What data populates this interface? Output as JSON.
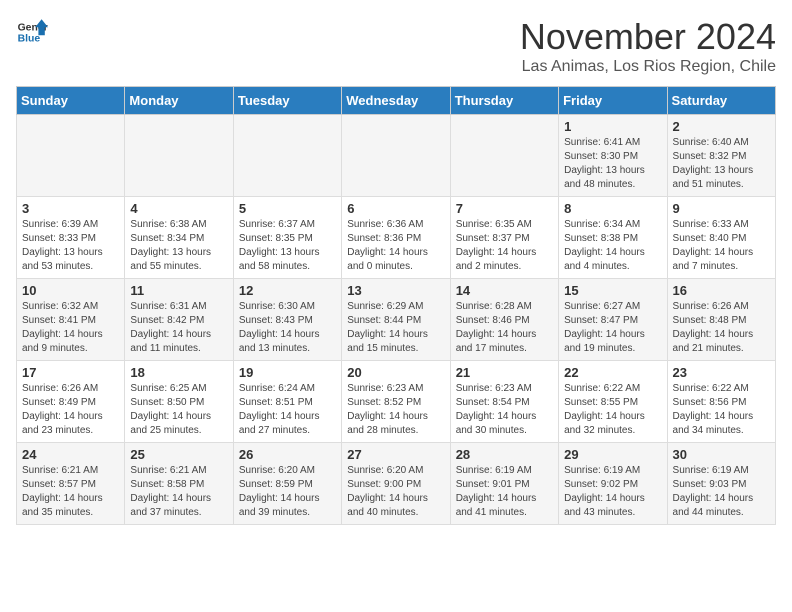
{
  "logo": {
    "line1": "General",
    "line2": "Blue"
  },
  "title": "November 2024",
  "location": "Las Animas, Los Rios Region, Chile",
  "weekdays": [
    "Sunday",
    "Monday",
    "Tuesday",
    "Wednesday",
    "Thursday",
    "Friday",
    "Saturday"
  ],
  "weeks": [
    [
      {
        "day": "",
        "detail": ""
      },
      {
        "day": "",
        "detail": ""
      },
      {
        "day": "",
        "detail": ""
      },
      {
        "day": "",
        "detail": ""
      },
      {
        "day": "",
        "detail": ""
      },
      {
        "day": "1",
        "detail": "Sunrise: 6:41 AM\nSunset: 8:30 PM\nDaylight: 13 hours and 48 minutes."
      },
      {
        "day": "2",
        "detail": "Sunrise: 6:40 AM\nSunset: 8:32 PM\nDaylight: 13 hours and 51 minutes."
      }
    ],
    [
      {
        "day": "3",
        "detail": "Sunrise: 6:39 AM\nSunset: 8:33 PM\nDaylight: 13 hours and 53 minutes."
      },
      {
        "day": "4",
        "detail": "Sunrise: 6:38 AM\nSunset: 8:34 PM\nDaylight: 13 hours and 55 minutes."
      },
      {
        "day": "5",
        "detail": "Sunrise: 6:37 AM\nSunset: 8:35 PM\nDaylight: 13 hours and 58 minutes."
      },
      {
        "day": "6",
        "detail": "Sunrise: 6:36 AM\nSunset: 8:36 PM\nDaylight: 14 hours and 0 minutes."
      },
      {
        "day": "7",
        "detail": "Sunrise: 6:35 AM\nSunset: 8:37 PM\nDaylight: 14 hours and 2 minutes."
      },
      {
        "day": "8",
        "detail": "Sunrise: 6:34 AM\nSunset: 8:38 PM\nDaylight: 14 hours and 4 minutes."
      },
      {
        "day": "9",
        "detail": "Sunrise: 6:33 AM\nSunset: 8:40 PM\nDaylight: 14 hours and 7 minutes."
      }
    ],
    [
      {
        "day": "10",
        "detail": "Sunrise: 6:32 AM\nSunset: 8:41 PM\nDaylight: 14 hours and 9 minutes."
      },
      {
        "day": "11",
        "detail": "Sunrise: 6:31 AM\nSunset: 8:42 PM\nDaylight: 14 hours and 11 minutes."
      },
      {
        "day": "12",
        "detail": "Sunrise: 6:30 AM\nSunset: 8:43 PM\nDaylight: 14 hours and 13 minutes."
      },
      {
        "day": "13",
        "detail": "Sunrise: 6:29 AM\nSunset: 8:44 PM\nDaylight: 14 hours and 15 minutes."
      },
      {
        "day": "14",
        "detail": "Sunrise: 6:28 AM\nSunset: 8:46 PM\nDaylight: 14 hours and 17 minutes."
      },
      {
        "day": "15",
        "detail": "Sunrise: 6:27 AM\nSunset: 8:47 PM\nDaylight: 14 hours and 19 minutes."
      },
      {
        "day": "16",
        "detail": "Sunrise: 6:26 AM\nSunset: 8:48 PM\nDaylight: 14 hours and 21 minutes."
      }
    ],
    [
      {
        "day": "17",
        "detail": "Sunrise: 6:26 AM\nSunset: 8:49 PM\nDaylight: 14 hours and 23 minutes."
      },
      {
        "day": "18",
        "detail": "Sunrise: 6:25 AM\nSunset: 8:50 PM\nDaylight: 14 hours and 25 minutes."
      },
      {
        "day": "19",
        "detail": "Sunrise: 6:24 AM\nSunset: 8:51 PM\nDaylight: 14 hours and 27 minutes."
      },
      {
        "day": "20",
        "detail": "Sunrise: 6:23 AM\nSunset: 8:52 PM\nDaylight: 14 hours and 28 minutes."
      },
      {
        "day": "21",
        "detail": "Sunrise: 6:23 AM\nSunset: 8:54 PM\nDaylight: 14 hours and 30 minutes."
      },
      {
        "day": "22",
        "detail": "Sunrise: 6:22 AM\nSunset: 8:55 PM\nDaylight: 14 hours and 32 minutes."
      },
      {
        "day": "23",
        "detail": "Sunrise: 6:22 AM\nSunset: 8:56 PM\nDaylight: 14 hours and 34 minutes."
      }
    ],
    [
      {
        "day": "24",
        "detail": "Sunrise: 6:21 AM\nSunset: 8:57 PM\nDaylight: 14 hours and 35 minutes."
      },
      {
        "day": "25",
        "detail": "Sunrise: 6:21 AM\nSunset: 8:58 PM\nDaylight: 14 hours and 37 minutes."
      },
      {
        "day": "26",
        "detail": "Sunrise: 6:20 AM\nSunset: 8:59 PM\nDaylight: 14 hours and 39 minutes."
      },
      {
        "day": "27",
        "detail": "Sunrise: 6:20 AM\nSunset: 9:00 PM\nDaylight: 14 hours and 40 minutes."
      },
      {
        "day": "28",
        "detail": "Sunrise: 6:19 AM\nSunset: 9:01 PM\nDaylight: 14 hours and 41 minutes."
      },
      {
        "day": "29",
        "detail": "Sunrise: 6:19 AM\nSunset: 9:02 PM\nDaylight: 14 hours and 43 minutes."
      },
      {
        "day": "30",
        "detail": "Sunrise: 6:19 AM\nSunset: 9:03 PM\nDaylight: 14 hours and 44 minutes."
      }
    ]
  ]
}
